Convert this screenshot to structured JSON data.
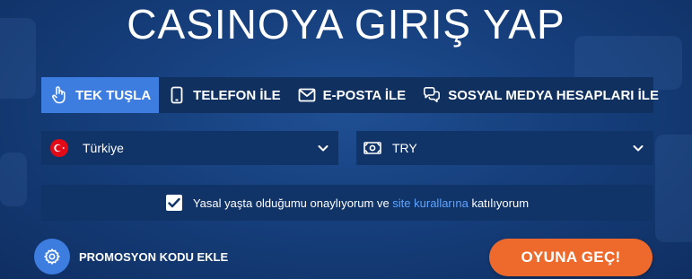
{
  "title": "CASINOYA GIRIŞ YAP",
  "tabs": [
    {
      "label": "TEK TUŞLA",
      "icon": "hand-pointer-icon",
      "active": true
    },
    {
      "label": "TELEFON İLE",
      "icon": "phone-icon",
      "active": false
    },
    {
      "label": "E-POSTA İLE",
      "icon": "envelope-icon",
      "active": false
    },
    {
      "label": "SOSYAL MEDYA HESAPLARI İLE",
      "icon": "chat-bubbles-icon",
      "active": false
    }
  ],
  "country_select": {
    "value": "Türkiye",
    "icon": "turkey-flag-icon"
  },
  "currency_select": {
    "value": "TRY",
    "icon": "money-icon"
  },
  "agreement": {
    "checked": true,
    "text_before": "Yasal yaşta olduğumu onaylıyorum ve ",
    "link_text": "site kurallarına",
    "text_after": " katılıyorum"
  },
  "promo": {
    "label": "PROMOSYON KODU EKLE",
    "icon": "gear-icon"
  },
  "submit": {
    "label": "OYUNA GEÇ!"
  },
  "colors": {
    "accent": "#3d7de0",
    "cta": "#ee6a2c",
    "link": "#5fa3ff",
    "panel": "#113468",
    "background": "#163f7c"
  }
}
